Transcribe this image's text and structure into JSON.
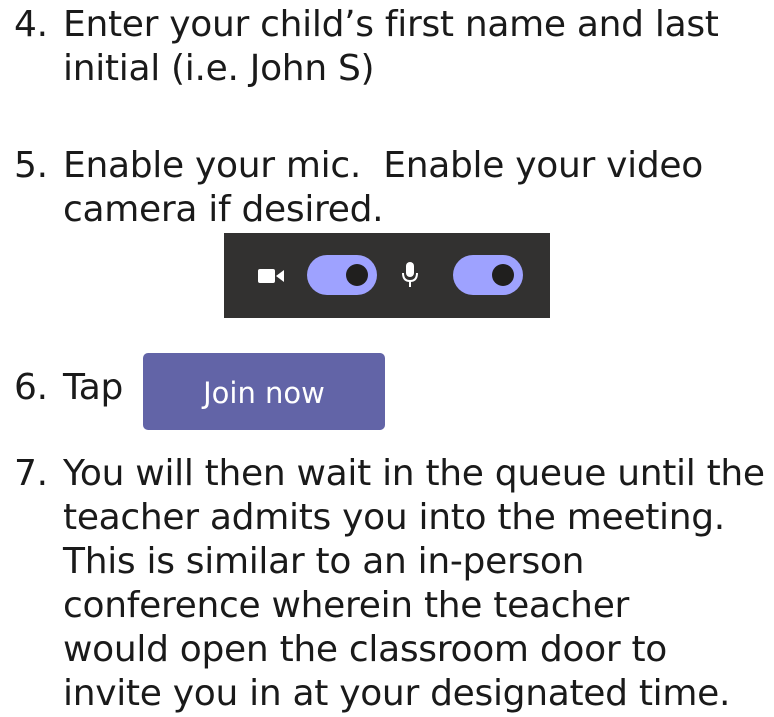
{
  "steps": [
    {
      "number": "4.",
      "lines": [
        "Enter your child’s first name and last",
        "initial (i.e. John S)"
      ]
    },
    {
      "number": "5.",
      "lines": [
        "Enable your mic.  Enable your video",
        "camera if desired."
      ]
    },
    {
      "number": "6.",
      "lines": [
        "Tap"
      ]
    },
    {
      "number": "7.",
      "lines": [
        "You will then wait in the queue until the",
        "teacher admits you into the meeting.",
        "This is similar to an in-person",
        "conference wherein the teacher",
        "would open the classroom door to",
        "invite you in at your designated time."
      ]
    }
  ],
  "toolbar": {
    "background": "#323130",
    "toggle_color": "#9ea2ff",
    "icons": [
      "video-camera-icon",
      "microphone-icon"
    ],
    "video_enabled": true,
    "mic_enabled": true
  },
  "join_button": {
    "label": "Join now",
    "color": "#6264a7"
  }
}
